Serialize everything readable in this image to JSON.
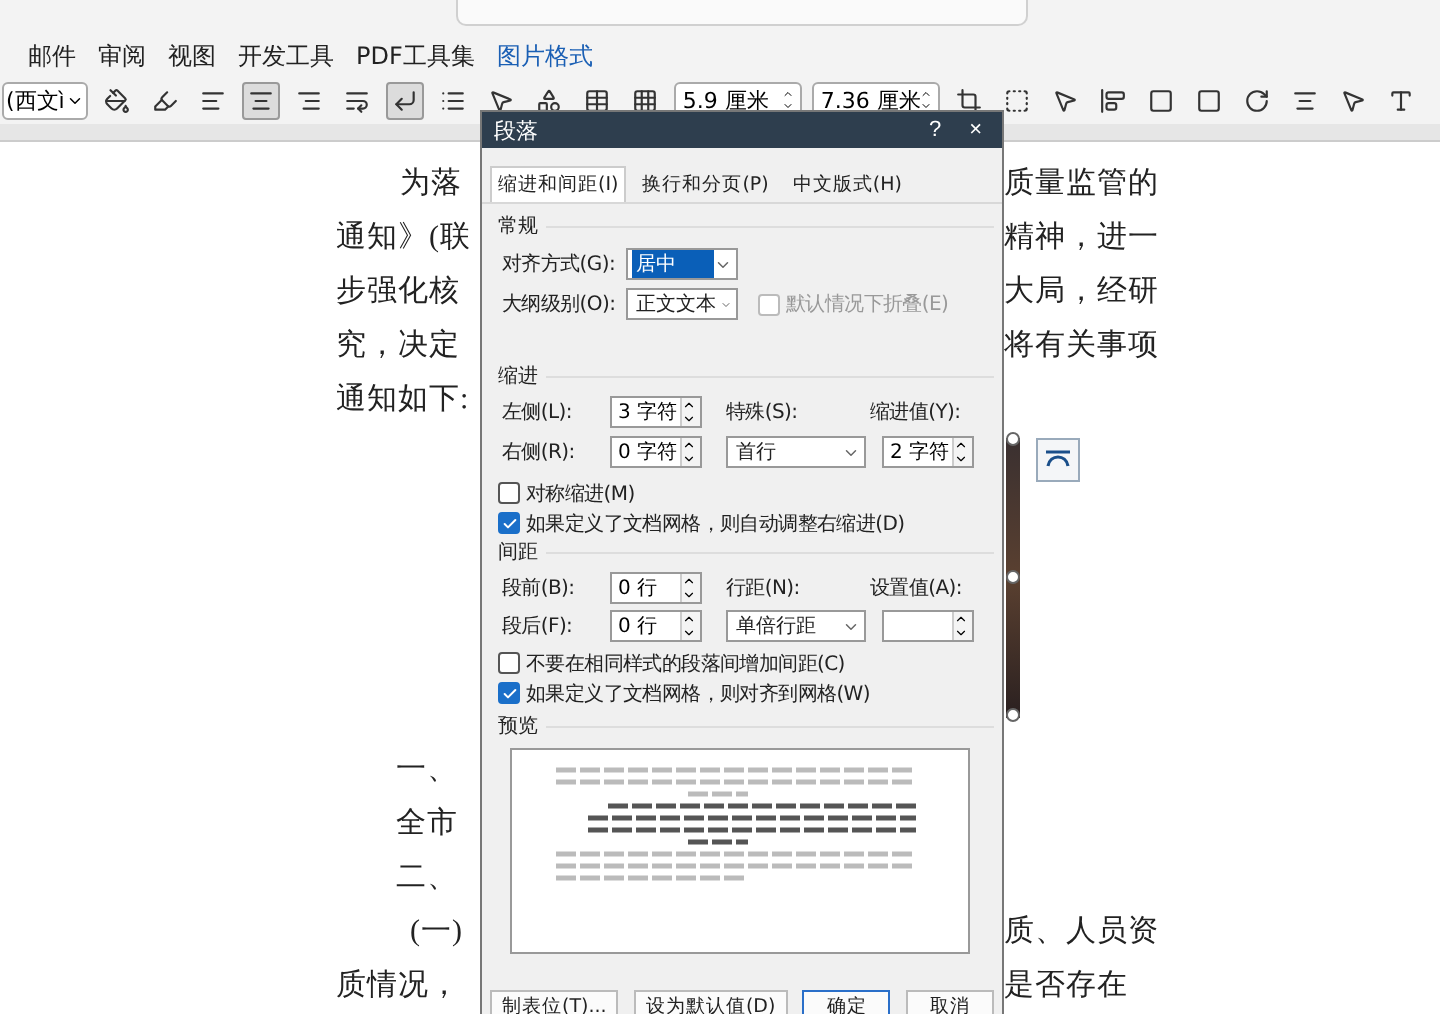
{
  "menu_tabs": [
    {
      "label": "邮件",
      "selected": false
    },
    {
      "label": "审阅",
      "selected": false
    },
    {
      "label": "视图",
      "selected": false
    },
    {
      "label": "开发工具",
      "selected": false
    },
    {
      "label": "PDF工具集",
      "selected": false
    },
    {
      "label": "图片格式",
      "selected": true
    }
  ],
  "toolbar": {
    "font_box": "(西文ì",
    "size_fields": [
      "5.9 厘米",
      "7.36 厘米"
    ]
  },
  "document": {
    "lines_top": [
      {
        "kind": "indented",
        "left": "为落",
        "right": "质量监管的"
      },
      {
        "kind": "flush",
        "left": "通知》(联",
        "right": "精神，进一"
      },
      {
        "kind": "flush",
        "left": "步强化核",
        "right": "大局，经研"
      },
      {
        "kind": "flush",
        "left": "究，决定",
        "right": "将有关事项"
      },
      {
        "kind": "flush",
        "left": "通知如下:"
      }
    ],
    "lines_bottom": [
      {
        "kind": "heading",
        "left": "一、"
      },
      {
        "kind": "heading",
        "left": "全市"
      },
      {
        "kind": "heading",
        "left": "二、"
      },
      {
        "kind": "sub",
        "left": "(一)",
        "right": "质、人员资"
      },
      {
        "kind": "flush",
        "left": "质情况，",
        "right": "是否存在"
      }
    ]
  },
  "dialog": {
    "title": "段落",
    "help": "?",
    "close": "×",
    "tabs": [
      {
        "label": "缩进和间距(I)",
        "selected": true
      },
      {
        "label": "换行和分页(P)",
        "selected": false
      },
      {
        "label": "中文版式(H)",
        "selected": false
      }
    ],
    "general": {
      "heading": "常规",
      "alignment": {
        "label": "对齐方式(G):",
        "value": "居中",
        "highlighted": true
      },
      "outline": {
        "label": "大纲级别(O):",
        "value": "正文文本",
        "highlighted": false
      },
      "collapse": {
        "label": "默认情况下折叠(E)",
        "checked": false,
        "disabled": true
      }
    },
    "indent": {
      "heading": "缩进",
      "left": {
        "label": "左侧(L):",
        "value": "3 字符"
      },
      "right": {
        "label": "右侧(R):",
        "value": "0 字符"
      },
      "special": {
        "label": "特殊(S):",
        "value": "首行"
      },
      "by": {
        "label": "缩进值(Y):",
        "value": "2 字符"
      },
      "options": [
        {
          "label": "对称缩进(M)",
          "checked": false
        },
        {
          "label": "如果定义了文档网格，则自动调整右缩进(D)",
          "checked": true
        }
      ]
    },
    "spacing": {
      "heading": "间距",
      "before": {
        "label": "段前(B):",
        "value": "0 行"
      },
      "after": {
        "label": "段后(F):",
        "value": "0 行"
      },
      "line": {
        "label": "行距(N):",
        "value": "单倍行距"
      },
      "at": {
        "label": "设置值(A):"
      },
      "options": [
        {
          "label": "不要在相同样式的段落间增加间距(C)",
          "checked": false
        },
        {
          "label": "如果定义了文档网格，则对齐到网格(W)",
          "checked": true
        }
      ]
    },
    "preview": {
      "heading": "预览"
    },
    "buttons": [
      {
        "label": "制表位(T)...",
        "kind": "plain"
      },
      {
        "label": "设为默认值(D)",
        "kind": "plain"
      },
      {
        "label": "确定",
        "kind": "default"
      },
      {
        "label": "取消",
        "kind": "plain"
      }
    ]
  }
}
